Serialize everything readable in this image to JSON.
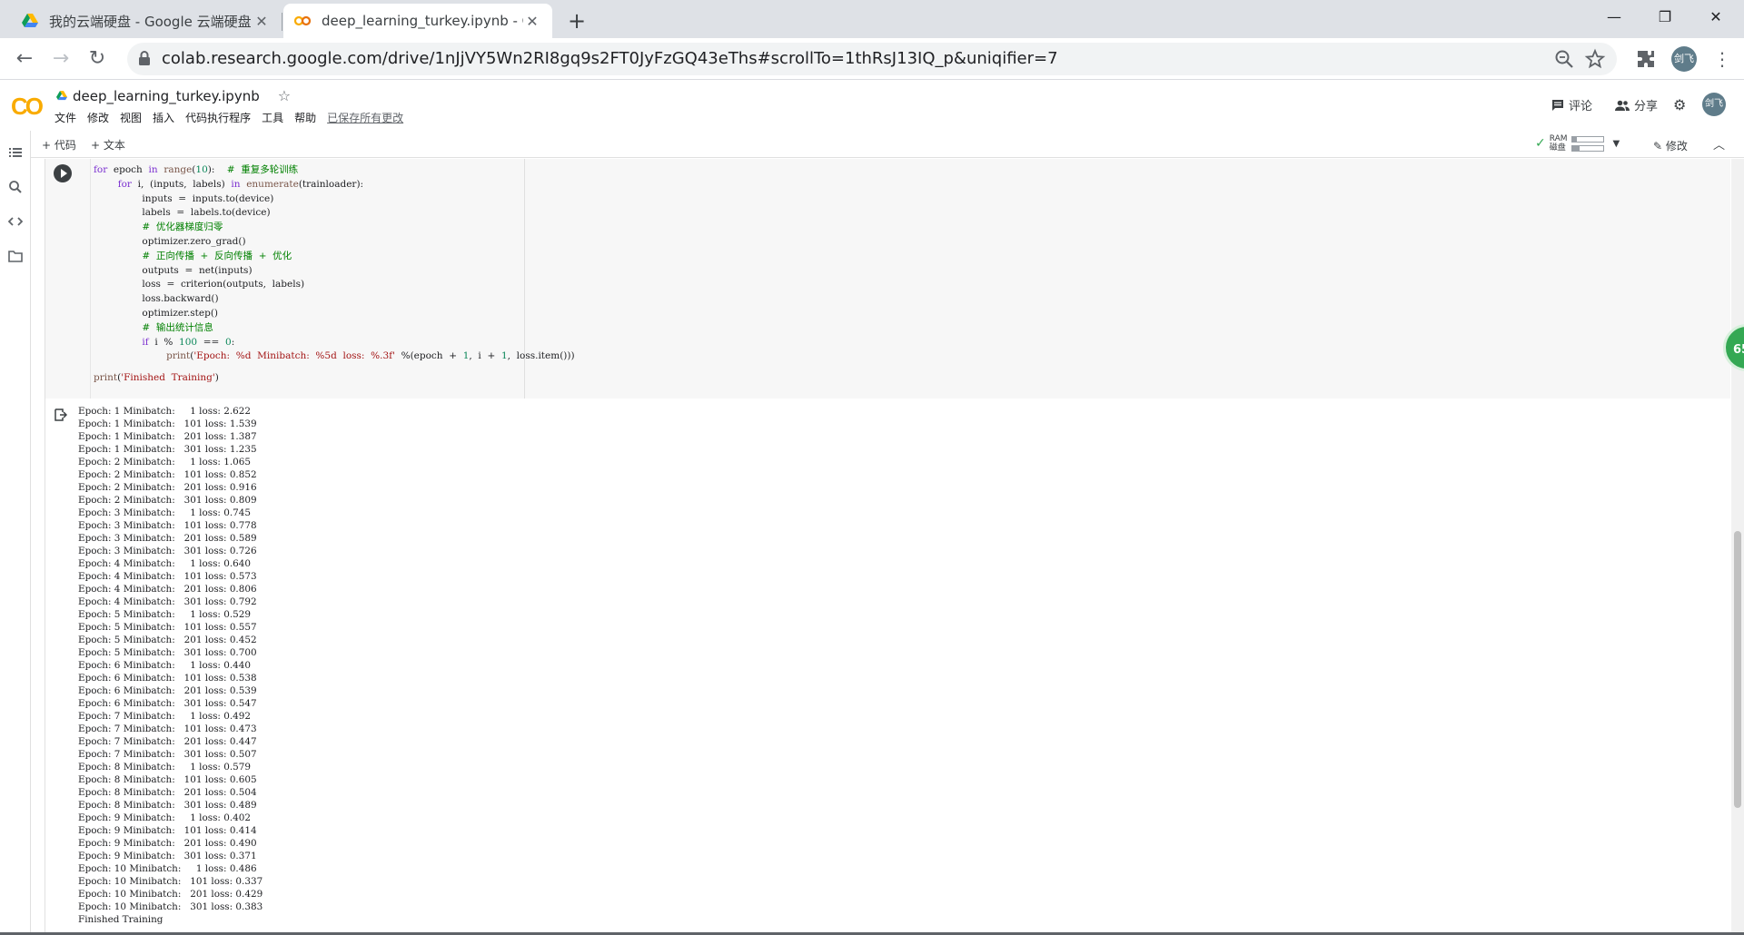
{
  "browser": {
    "tabs": [
      {
        "title": "我的云端硬盘 - Google 云端硬盘",
        "active": false
      },
      {
        "title": "deep_learning_turkey.ipynb - Colaboratory",
        "active": true
      }
    ],
    "url": "colab.research.google.com/drive/1nJjVY5Wn2RI8gq9s2FT0JyFzGQ43eThs#scrollTo=1thRsJ13IQ_p&uniqifier=7",
    "profile_initials": "剑飞"
  },
  "colab": {
    "logo": "CO",
    "notebook_title": "deep_learning_turkey.ipynb",
    "menu": [
      "文件",
      "修改",
      "视图",
      "插入",
      "代码执行程序",
      "工具",
      "帮助"
    ],
    "saved_status": "已保存所有更改",
    "comment_label": "评论",
    "share_label": "分享",
    "add_code_label": "+ 代码",
    "add_text_label": "+ 文本",
    "ram_label": "RAM",
    "disk_label": "磁盘",
    "ram_fill": 0.15,
    "disk_fill": 0.25,
    "edit_label": "修改",
    "badge_value": "65"
  },
  "code_lines": [
    [
      {
        "t": "for",
        "c": "kw"
      },
      {
        "t": "  epoch  "
      },
      {
        "t": "in",
        "c": "kw"
      },
      {
        "t": "  "
      },
      {
        "t": "range",
        "c": "bi"
      },
      {
        "t": "("
      },
      {
        "t": "10",
        "c": "nm"
      },
      {
        "t": "):    "
      },
      {
        "t": "#  重复多轮训练",
        "c": "cm"
      }
    ],
    [
      {
        "t": "        "
      },
      {
        "t": "for",
        "c": "kw"
      },
      {
        "t": "  i,  (inputs,  labels)  "
      },
      {
        "t": "in",
        "c": "kw"
      },
      {
        "t": "  "
      },
      {
        "t": "enumerate",
        "c": "bi"
      },
      {
        "t": "(trainloader):"
      }
    ],
    [
      {
        "t": "                inputs  =  inputs.to(device)"
      }
    ],
    [
      {
        "t": "                labels  =  labels.to(device)"
      }
    ],
    [
      {
        "t": "                "
      },
      {
        "t": "#  优化器梯度归零",
        "c": "cm"
      }
    ],
    [
      {
        "t": "                optimizer.zero_grad()"
      }
    ],
    [
      {
        "t": "                "
      },
      {
        "t": "#  正向传播  +  反向传播  +  优化",
        "c": "cm"
      }
    ],
    [
      {
        "t": "                outputs  =  net(inputs)"
      }
    ],
    [
      {
        "t": "                loss  =  criterion(outputs,  labels)"
      }
    ],
    [
      {
        "t": "                loss.backward()"
      }
    ],
    [
      {
        "t": "                optimizer.step()"
      }
    ],
    [
      {
        "t": "                "
      },
      {
        "t": "#  输出统计信息",
        "c": "cm"
      }
    ],
    [
      {
        "t": "                "
      },
      {
        "t": "if",
        "c": "kw"
      },
      {
        "t": "  i  %  "
      },
      {
        "t": "100",
        "c": "nm"
      },
      {
        "t": "  ==  "
      },
      {
        "t": "0",
        "c": "nm"
      },
      {
        "t": ":"
      }
    ],
    [
      {
        "t": "                        "
      },
      {
        "t": "print",
        "c": "bi"
      },
      {
        "t": "("
      },
      {
        "t": "'Epoch:  %d  Minibatch:  %5d  loss:  %.3f'",
        "c": "st"
      },
      {
        "t": "  %(epoch  +  "
      },
      {
        "t": "1",
        "c": "nm"
      },
      {
        "t": ",  i  +  "
      },
      {
        "t": "1",
        "c": "nm"
      },
      {
        "t": ",  loss.item()))"
      }
    ],
    [
      {
        "t": ""
      }
    ],
    [
      {
        "t": "print",
        "c": "bi"
      },
      {
        "t": "("
      },
      {
        "t": "'Finished  Training'",
        "c": "st"
      },
      {
        "t": ")"
      }
    ]
  ],
  "output_lines": [
    "Epoch: 1 Minibatch:     1 loss: 2.622",
    "Epoch: 1 Minibatch:   101 loss: 1.539",
    "Epoch: 1 Minibatch:   201 loss: 1.387",
    "Epoch: 1 Minibatch:   301 loss: 1.235",
    "Epoch: 2 Minibatch:     1 loss: 1.065",
    "Epoch: 2 Minibatch:   101 loss: 0.852",
    "Epoch: 2 Minibatch:   201 loss: 0.916",
    "Epoch: 2 Minibatch:   301 loss: 0.809",
    "Epoch: 3 Minibatch:     1 loss: 0.745",
    "Epoch: 3 Minibatch:   101 loss: 0.778",
    "Epoch: 3 Minibatch:   201 loss: 0.589",
    "Epoch: 3 Minibatch:   301 loss: 0.726",
    "Epoch: 4 Minibatch:     1 loss: 0.640",
    "Epoch: 4 Minibatch:   101 loss: 0.573",
    "Epoch: 4 Minibatch:   201 loss: 0.806",
    "Epoch: 4 Minibatch:   301 loss: 0.792",
    "Epoch: 5 Minibatch:     1 loss: 0.529",
    "Epoch: 5 Minibatch:   101 loss: 0.557",
    "Epoch: 5 Minibatch:   201 loss: 0.452",
    "Epoch: 5 Minibatch:   301 loss: 0.700",
    "Epoch: 6 Minibatch:     1 loss: 0.440",
    "Epoch: 6 Minibatch:   101 loss: 0.538",
    "Epoch: 6 Minibatch:   201 loss: 0.539",
    "Epoch: 6 Minibatch:   301 loss: 0.547",
    "Epoch: 7 Minibatch:     1 loss: 0.492",
    "Epoch: 7 Minibatch:   101 loss: 0.473",
    "Epoch: 7 Minibatch:   201 loss: 0.447",
    "Epoch: 7 Minibatch:   301 loss: 0.507",
    "Epoch: 8 Minibatch:     1 loss: 0.579",
    "Epoch: 8 Minibatch:   101 loss: 0.605",
    "Epoch: 8 Minibatch:   201 loss: 0.504",
    "Epoch: 8 Minibatch:   301 loss: 0.489",
    "Epoch: 9 Minibatch:     1 loss: 0.402",
    "Epoch: 9 Minibatch:   101 loss: 0.414",
    "Epoch: 9 Minibatch:   201 loss: 0.490",
    "Epoch: 9 Minibatch:   301 loss: 0.371",
    "Epoch: 10 Minibatch:     1 loss: 0.486",
    "Epoch: 10 Minibatch:   101 loss: 0.337",
    "Epoch: 10 Minibatch:   201 loss: 0.429",
    "Epoch: 10 Minibatch:   301 loss: 0.383",
    "Finished Training"
  ]
}
